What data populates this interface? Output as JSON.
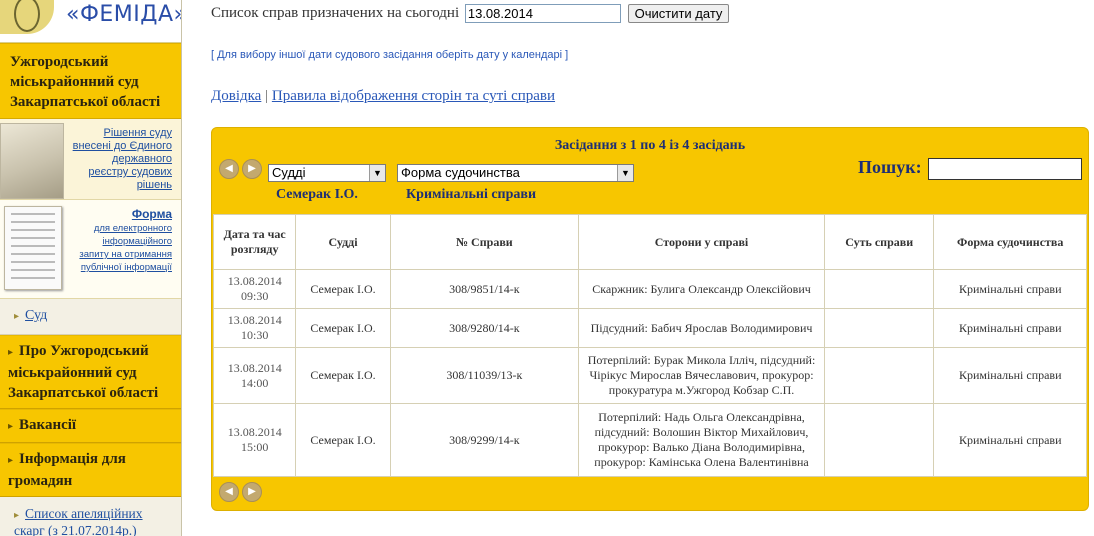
{
  "logo": {
    "brand": "«ФЕМІДА»",
    "emblem": "themis-emblem"
  },
  "sidebar": {
    "court_name": "Ужгородський міськрайонний суд Закарпатської області",
    "promo_decisions": {
      "text": "Рішення суду внесені до Єдиного державного реєстру судових рішень",
      "image": "book-image"
    },
    "promo_form": {
      "title": "Форма",
      "text": "для електронного інформаційного запиту на отримання публічної інформації",
      "image": "form-document-image"
    },
    "nav_court": "Суд",
    "nav_about": "Про Ужгородський міськрайонний суд Закарпатської області",
    "nav_vacancies": "Вакансії",
    "nav_info": "Інформація для громадян",
    "nav_appeals": "Список апеляційних скарг (з 21.07.2014р.)"
  },
  "header": {
    "date_label": "Список справ призначених на сьогодні",
    "date_value": "13.08.2014",
    "clear_button": "Очистити дату",
    "calendar_hint": "[ Для вибору іншої дати судового засідання оберіть дату у календарі ]",
    "link_help": "Довідка",
    "link_separator": "|",
    "link_rules": "Правила відображення сторін та суті справи"
  },
  "panel": {
    "title": "Засідання з 1 по 4 із 4 засідань",
    "judge_select": "Судді",
    "form_select": "Форма судочинства",
    "judge_value": "Семерак І.О.",
    "form_value": "Кримінальні справи",
    "search_label": "Пошук:",
    "search_value": "",
    "colors": {
      "panel_bg": "#f7c600",
      "title": "#1e2f74"
    }
  },
  "table": {
    "headers": {
      "date": "Дата та час розгляду",
      "judges": "Судді",
      "case_no": "№ Справи",
      "parties": "Сторони у справі",
      "essence": "Суть справи",
      "form": "Форма судочинства"
    },
    "rows": [
      {
        "date": "13.08.2014",
        "time": "09:30",
        "judge": "Семерак І.О.",
        "case_no": "308/9851/14-к",
        "parties": "Скаржник: Булига Олександр Олексійович",
        "essence": "",
        "form": "Кримінальні справи"
      },
      {
        "date": "13.08.2014",
        "time": "10:30",
        "judge": "Семерак І.О.",
        "case_no": "308/9280/14-к",
        "parties": "Підсудний: Бабич Ярослав Володимирович",
        "essence": "",
        "form": "Кримінальні справи"
      },
      {
        "date": "13.08.2014",
        "time": "14:00",
        "judge": "Семерак І.О.",
        "case_no": "308/11039/13-к",
        "parties": "Потерпілий: Бурак Микола Ілліч, підсудний: Чірікус Мирослав Вячеславович, прокурор: прокуратура м.Ужгород Кобзар С.П.",
        "essence": "",
        "form": "Кримінальні справи"
      },
      {
        "date": "13.08.2014",
        "time": "15:00",
        "judge": "Семерак І.О.",
        "case_no": "308/9299/14-к",
        "parties": "Потерпілий: Надь Ольга Олександрівна, підсудний: Волошин Віктор Михайлович, прокурор: Валько Діана Володимирівна, прокурор: Камінська Олена Валентинівна",
        "essence": "",
        "form": "Кримінальні справи"
      }
    ]
  }
}
